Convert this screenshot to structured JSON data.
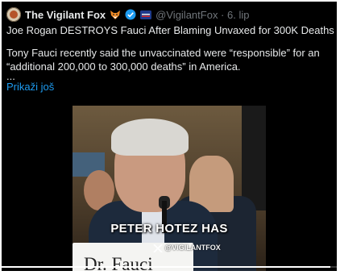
{
  "post": {
    "author_name": "The Vigilant Fox",
    "handle_date": "@VigilantFox · 6. lip",
    "text_lines": [
      "Joe Rogan DESTROYS Fauci After Blaming Unvaxed for 300K Deaths",
      "Tony Fauci recently said the unvaccinated were “responsible” for an",
      "“additional 200,000 to 300,000 deaths” in America.",
      "..."
    ],
    "show_more": "Prikaži još"
  },
  "video": {
    "caption": "PETER HOTEZ HAS",
    "watermark": "@VIGILANTFOX",
    "nameplate": "Dr. Fauci",
    "progress": 0.98
  },
  "icons": {
    "fox": "fox-emoji-icon",
    "verified": "verified-badge-icon",
    "flag": "affiliation-flag-icon",
    "watermark_logo": "x-logo-icon"
  },
  "colors": {
    "background": "#000000",
    "text": "#e7e9ea",
    "muted": "#71767b",
    "link": "#1d9bf0",
    "verified": "#1d9bf0"
  }
}
